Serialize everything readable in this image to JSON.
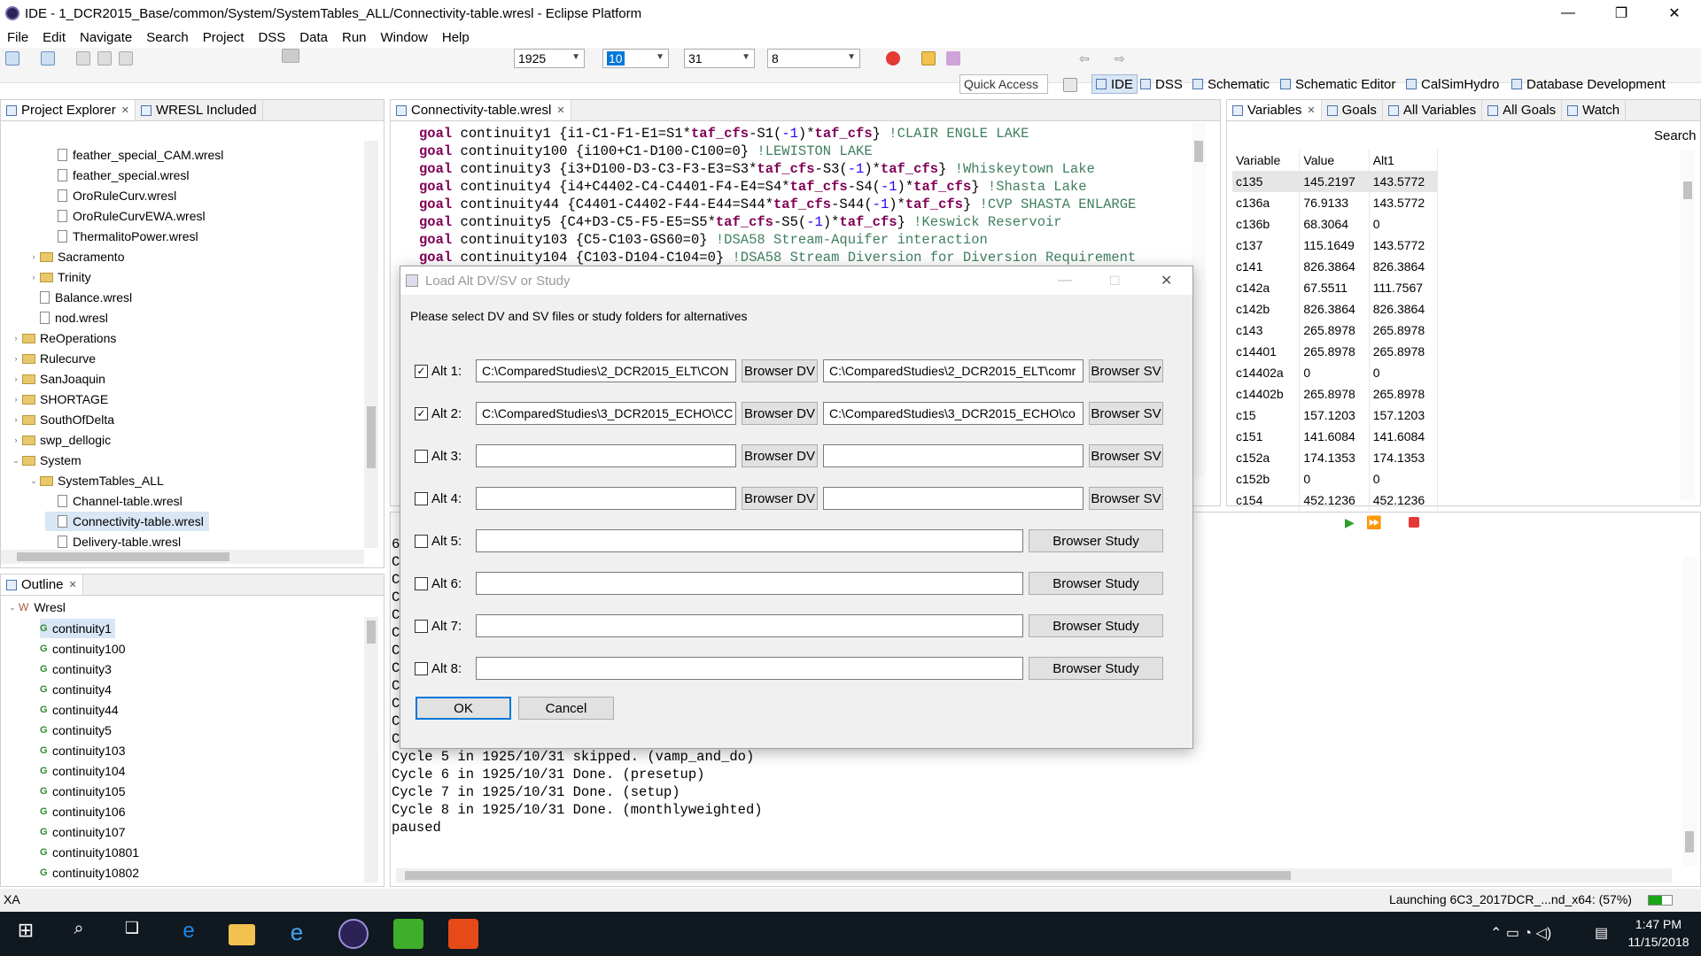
{
  "window": {
    "title": "IDE - 1_DCR2015_Base/common/System/SystemTables_ALL/Connectivity-table.wresl - Eclipse Platform",
    "min": "—",
    "max": "❐",
    "close": "✕"
  },
  "menu": [
    "File",
    "Edit",
    "Navigate",
    "Search",
    "Project",
    "DSS",
    "Data",
    "Run",
    "Window",
    "Help"
  ],
  "toolbar": {
    "year": "1925",
    "month": "10",
    "day": "31",
    "cycle": "8",
    "quick_access": "Quick Access",
    "perspectives": [
      "IDE",
      "DSS",
      "Schematic",
      "Schematic Editor",
      "CalSimHydro",
      "Database Development"
    ]
  },
  "project_explorer": {
    "tabs": [
      "Project Explorer",
      "WRESL Included"
    ],
    "rows": [
      {
        "label": "feather_special_CAM.wresl",
        "type": "file",
        "indent": 4
      },
      {
        "label": "feather_special.wresl",
        "type": "file",
        "indent": 4
      },
      {
        "label": "OroRuleCurv.wresl",
        "type": "file",
        "indent": 4
      },
      {
        "label": "OroRuleCurvEWA.wresl",
        "type": "file",
        "indent": 4
      },
      {
        "label": "ThermalitoPower.wresl",
        "type": "file",
        "indent": 4
      },
      {
        "label": "Sacramento",
        "type": "folder",
        "indent": 3,
        "arrow": "›"
      },
      {
        "label": "Trinity",
        "type": "folder",
        "indent": 3,
        "arrow": "›"
      },
      {
        "label": "Balance.wresl",
        "type": "file",
        "indent": 3
      },
      {
        "label": "nod.wresl",
        "type": "file",
        "indent": 3
      },
      {
        "label": "ReOperations",
        "type": "folder",
        "indent": 2,
        "arrow": "›"
      },
      {
        "label": "Rulecurve",
        "type": "folder",
        "indent": 2,
        "arrow": "›"
      },
      {
        "label": "SanJoaquin",
        "type": "folder",
        "indent": 2,
        "arrow": "›"
      },
      {
        "label": "SHORTAGE",
        "type": "folder",
        "indent": 2,
        "arrow": "›"
      },
      {
        "label": "SouthOfDelta",
        "type": "folder",
        "indent": 2,
        "arrow": "›"
      },
      {
        "label": "swp_dellogic",
        "type": "folder",
        "indent": 2,
        "arrow": "›"
      },
      {
        "label": "System",
        "type": "folder",
        "indent": 2,
        "arrow": "⌄"
      },
      {
        "label": "SystemTables_ALL",
        "type": "folder",
        "indent": 3,
        "arrow": "⌄"
      },
      {
        "label": "Channel-table.wresl",
        "type": "file",
        "indent": 4
      },
      {
        "label": "Connectivity-table.wresl",
        "type": "file",
        "indent": 4,
        "selected": true
      },
      {
        "label": "Delivery-table.wresl",
        "type": "file",
        "indent": 4
      }
    ]
  },
  "outline": {
    "tab": "Outline",
    "root": "Wresl",
    "items": [
      "continuity1",
      "continuity100",
      "continuity3",
      "continuity4",
      "continuity44",
      "continuity5",
      "continuity103",
      "continuity104",
      "continuity105",
      "continuity106",
      "continuity107",
      "continuity10801",
      "continuity10802"
    ]
  },
  "editor": {
    "tab": "Connectivity-table.wresl",
    "lines": [
      {
        "kw": "goal",
        "name": " continuity1 ",
        "expr": "{i1-C1-F1-E1=S1*",
        "b1": "taf_cfs",
        "e2": "-S1(",
        "n": "-1",
        "e3": ")*",
        "b2": "taf_cfs",
        "e4": "}",
        "cm": " !CLAIR ENGLE LAKE"
      },
      {
        "kw": "goal",
        "name": " continuity100 ",
        "expr": "{i100+C1-D100-C100=0}",
        "b1": "",
        "e2": "",
        "n": "",
        "e3": "",
        "b2": "",
        "e4": "",
        "cm": " !LEWISTON LAKE"
      },
      {
        "kw": "goal",
        "name": " continuity3 ",
        "expr": "{i3+D100-D3-C3-F3-E3=S3*",
        "b1": "taf_cfs",
        "e2": "-S3(",
        "n": "-1",
        "e3": ")*",
        "b2": "taf_cfs",
        "e4": "}",
        "cm": " !Whiskeytown Lake"
      },
      {
        "kw": "goal",
        "name": " continuity4 ",
        "expr": "{i4+C4402-C4-C4401-F4-E4=S4*",
        "b1": "taf_cfs",
        "e2": "-S4(",
        "n": "-1",
        "e3": ")*",
        "b2": "taf_cfs",
        "e4": "}",
        "cm": " !Shasta Lake"
      },
      {
        "kw": "goal",
        "name": " continuity44 ",
        "expr": "{C4401-C4402-F44-E44=S44*",
        "b1": "taf_cfs",
        "e2": "-S44(",
        "n": "-1",
        "e3": ")*",
        "b2": "taf_cfs",
        "e4": "}",
        "cm": " !CVP SHASTA ENLARGE"
      },
      {
        "kw": "goal",
        "name": " continuity5 ",
        "expr": "{C4+D3-C5-F5-E5=S5*",
        "b1": "taf_cfs",
        "e2": "-S5(",
        "n": "-1",
        "e3": ")*",
        "b2": "taf_cfs",
        "e4": "}",
        "cm": " !Keswick Reservoir"
      },
      {
        "kw": "goal",
        "name": " continuity103 ",
        "expr": "{C5-C103-GS60=0}",
        "b1": "",
        "e2": "",
        "n": "",
        "e3": "",
        "b2": "",
        "e4": "",
        "cm": " !DSA58 Stream-Aquifer interaction"
      },
      {
        "kw": "goal",
        "name": " continuity104 ",
        "expr": "{C103-D104-C104=0}",
        "b1": "",
        "e2": "",
        "n": "",
        "e3": "",
        "b2": "",
        "e4": "",
        "cm": " !DSA58 Stream Diversion for Diversion Requirement"
      }
    ]
  },
  "variables": {
    "tabs": [
      "Variables",
      "Goals",
      "All Variables",
      "All Goals",
      "Watch"
    ],
    "search_label": "Search",
    "headers": [
      "Variable",
      "Value",
      "Alt1"
    ],
    "rows": [
      [
        "c135",
        "145.2197",
        "143.5772"
      ],
      [
        "c136a",
        "76.9133",
        "143.5772"
      ],
      [
        "c136b",
        "68.3064",
        "0"
      ],
      [
        "c137",
        "115.1649",
        "143.5772"
      ],
      [
        "c141",
        "826.3864",
        "826.3864"
      ],
      [
        "c142a",
        "67.5511",
        "111.7567"
      ],
      [
        "c142b",
        "826.3864",
        "826.3864"
      ],
      [
        "c143",
        "265.8978",
        "265.8978"
      ],
      [
        "c14401",
        "265.8978",
        "265.8978"
      ],
      [
        "c14402a",
        "0",
        "0"
      ],
      [
        "c14402b",
        "265.8978",
        "265.8978"
      ],
      [
        "c15",
        "157.1203",
        "157.1203"
      ],
      [
        "c151",
        "141.6084",
        "141.6084"
      ],
      [
        "c152a",
        "174.1353",
        "174.1353"
      ],
      [
        "c152b",
        "0",
        "0"
      ],
      [
        "c154",
        "452.1236",
        "452.1236"
      ]
    ]
  },
  "console": {
    "lines": [
      "Cycle 5 in 1925/10/31 skipped. (vamp_and_do)",
      "Cycle 6 in 1925/10/31 Done. (presetup)",
      "Cycle 7 in 1925/10/31 Done. (setup)",
      "Cycle 8 in 1925/10/31 Done. (monthlyweighted)",
      "paused"
    ],
    "partial_left": [
      "60",
      "C",
      "C",
      "C",
      "C",
      "C",
      "C",
      "C",
      "C",
      "C",
      "C",
      "C"
    ]
  },
  "dialog": {
    "title": "Load Alt DV/SV or Study",
    "instruction": "Please select DV and SV files or study folders for alternatives",
    "alts": [
      {
        "label": "Alt 1:",
        "checked": true,
        "dv": "C:\\ComparedStudies\\2_DCR2015_ELT\\CON",
        "sv": "C:\\ComparedStudies\\2_DCR2015_ELT\\comr"
      },
      {
        "label": "Alt 2:",
        "checked": true,
        "dv": "C:\\ComparedStudies\\3_DCR2015_ECHO\\CC",
        "sv": "C:\\ComparedStudies\\3_DCR2015_ECHO\\co"
      },
      {
        "label": "Alt 3:",
        "checked": false,
        "dv": "",
        "sv": ""
      },
      {
        "label": "Alt 4:",
        "checked": false,
        "dv": "",
        "sv": ""
      }
    ],
    "study_alts": [
      {
        "label": "Alt 5:",
        "checked": false,
        "path": ""
      },
      {
        "label": "Alt 6:",
        "checked": false,
        "path": ""
      },
      {
        "label": "Alt 7:",
        "checked": false,
        "path": ""
      },
      {
        "label": "Alt 8:",
        "checked": false,
        "path": ""
      }
    ],
    "browse_dv": "Browser DV",
    "browse_sv": "Browser SV",
    "browse_study": "Browser Study",
    "ok": "OK",
    "cancel": "Cancel"
  },
  "status": {
    "left": "XA",
    "right": "Launching 6C3_2017DCR_...nd_x64: (57%)",
    "progress": 0.57
  },
  "taskbar": {
    "time": "1:47 PM",
    "date": "11/15/2018"
  }
}
